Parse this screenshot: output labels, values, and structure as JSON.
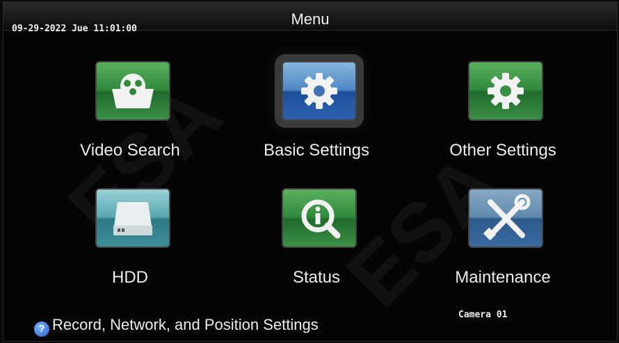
{
  "header": {
    "title": "Menu",
    "datetime": "09-29-2022 Jue 11:01:00"
  },
  "menu": {
    "items": [
      {
        "label": "Video Search",
        "icon": "video-reel-icon"
      },
      {
        "label": "Basic Settings",
        "icon": "gear-icon",
        "selected": true
      },
      {
        "label": "Other Settings",
        "icon": "gear-icon"
      },
      {
        "label": "HDD",
        "icon": "hard-drive-icon"
      },
      {
        "label": "Status",
        "icon": "info-magnifier-icon"
      },
      {
        "label": "Maintenance",
        "icon": "tools-icon"
      }
    ]
  },
  "footer": {
    "hint": "Record, Network, and Position Settings",
    "camera": "Camera 01"
  },
  "colors": {
    "green": "#2f8a3c",
    "blue": "#1e4f9a",
    "teal": "#2e7a86",
    "background": "#050505"
  }
}
